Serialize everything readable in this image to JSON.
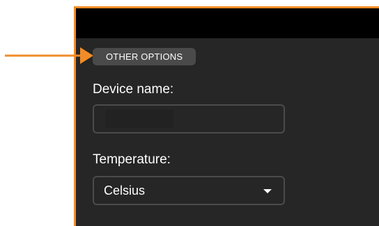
{
  "section": {
    "chip_label": "OTHER OPTIONS"
  },
  "fields": {
    "device_name": {
      "label": "Device name:",
      "value": ""
    },
    "temperature": {
      "label": "Temperature:",
      "selected": "Celsius"
    }
  },
  "icons": {
    "callout": "arrow-right-icon",
    "dropdown": "chevron-down-icon"
  },
  "colors": {
    "accent": "#f28c28",
    "panel_bg": "#262626",
    "header_bg": "#000000",
    "chip_bg": "#4a4a4a",
    "field_border": "#4b4b4b",
    "text": "#ffffff"
  }
}
